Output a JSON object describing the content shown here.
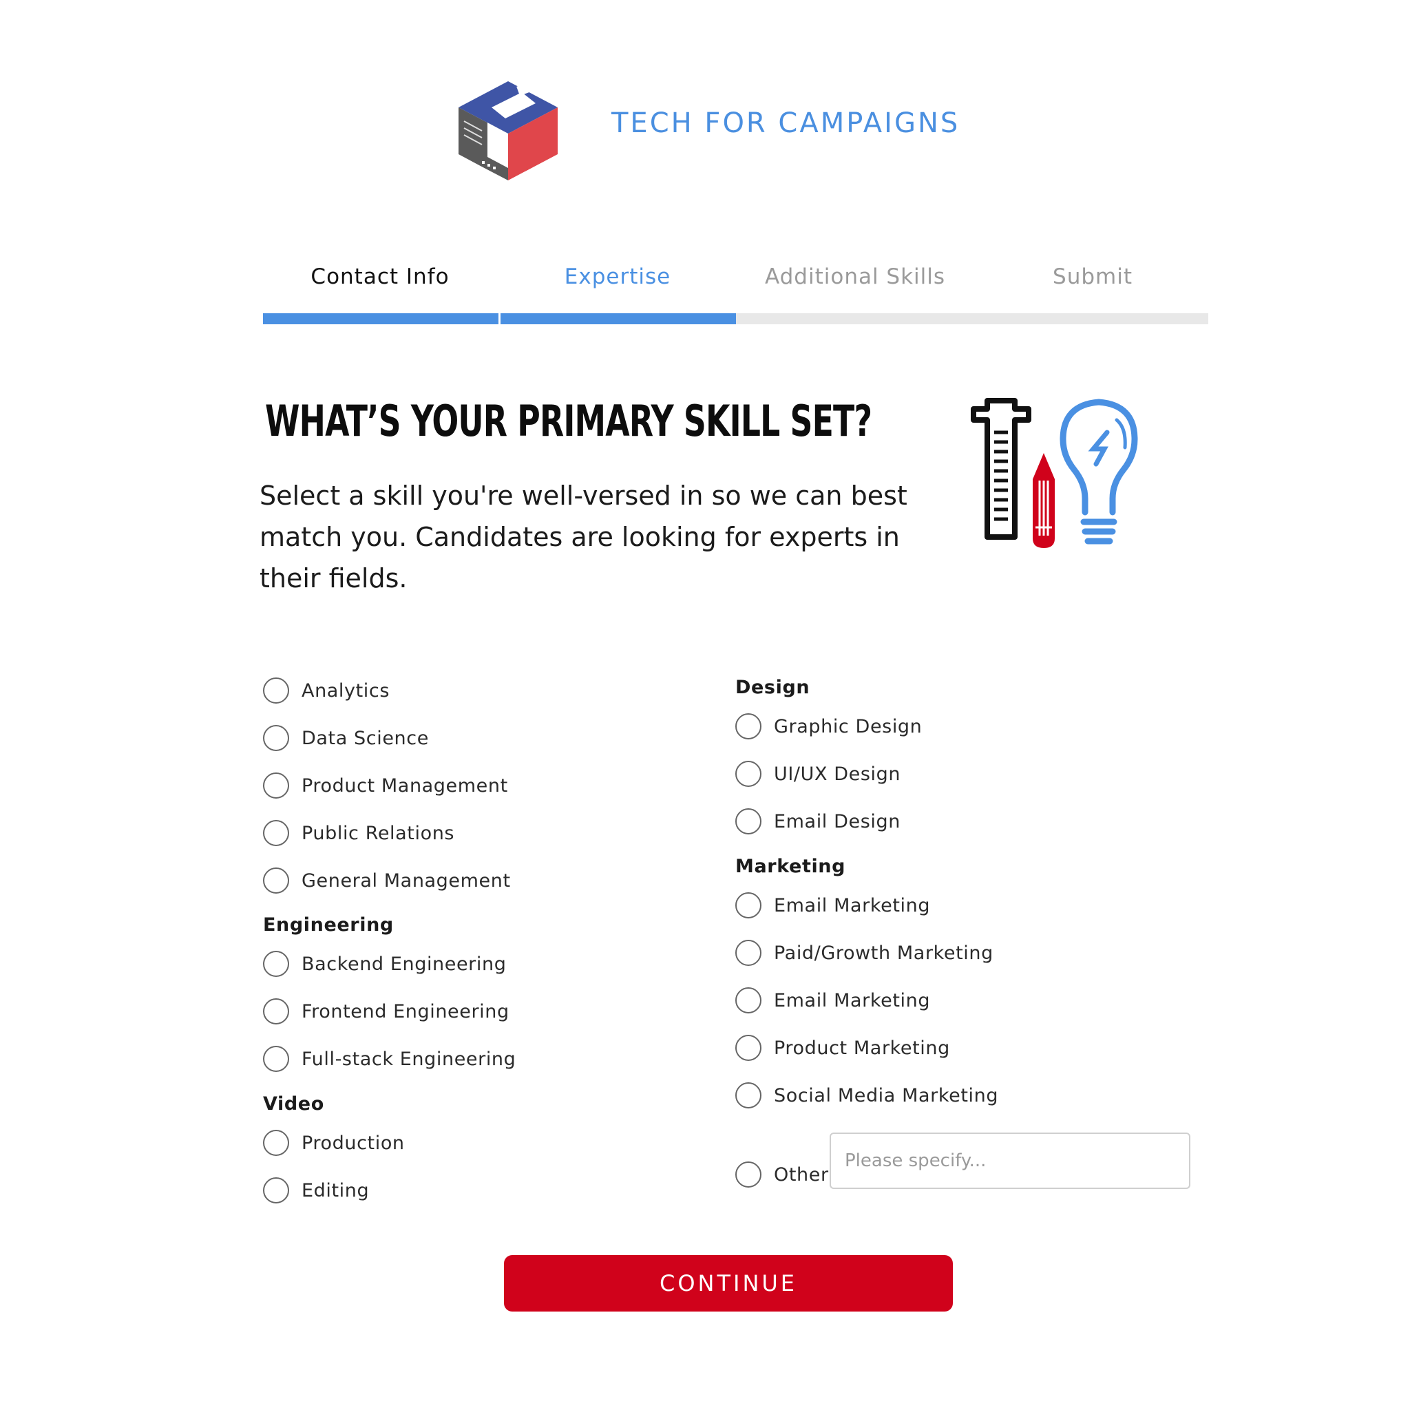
{
  "header": {
    "brand": "TECH FOR CAMPAIGNS"
  },
  "steps": [
    {
      "label": "Contact Info",
      "state": "done"
    },
    {
      "label": "Expertise",
      "state": "active"
    },
    {
      "label": "Additional Skills",
      "state": "todo"
    },
    {
      "label": "Submit",
      "state": "todo"
    }
  ],
  "progress": {
    "completed_steps": 2,
    "total_steps": 4
  },
  "question": {
    "title": "WHAT’S YOUR PRIMARY SKILL SET?",
    "intro": "Select a skill you're well-versed in so we can best match you. Candidates are looking for experts in their fields."
  },
  "options": {
    "general": [
      "Analytics",
      "Data Science",
      "Product Management",
      "Public Relations",
      "General Management"
    ],
    "engineering": {
      "title": "Engineering",
      "items": [
        "Backend Engineering",
        "Frontend Engineering",
        "Full-stack Engineering"
      ]
    },
    "video": {
      "title": "Video",
      "items": [
        "Production",
        "Editing"
      ]
    },
    "design": {
      "title": "Design",
      "items": [
        "Graphic Design",
        "UI/UX Design",
        "Email Design"
      ]
    },
    "marketing": {
      "title": "Marketing",
      "items": [
        "Email Marketing",
        "Paid/Growth Marketing",
        "Email Marketing",
        "Product Marketing",
        "Social Media Marketing"
      ]
    },
    "other": {
      "label": "Other",
      "placeholder": "Please specify..."
    }
  },
  "actions": {
    "continue": "CONTINUE"
  },
  "colors": {
    "accent_blue": "#4a90e2",
    "brand_red": "#d0021b",
    "track_gray": "#e8e8e8"
  },
  "icons": [
    "tech-for-campaigns-logo",
    "ruler-icon",
    "pencil-icon",
    "lightbulb-icon"
  ]
}
